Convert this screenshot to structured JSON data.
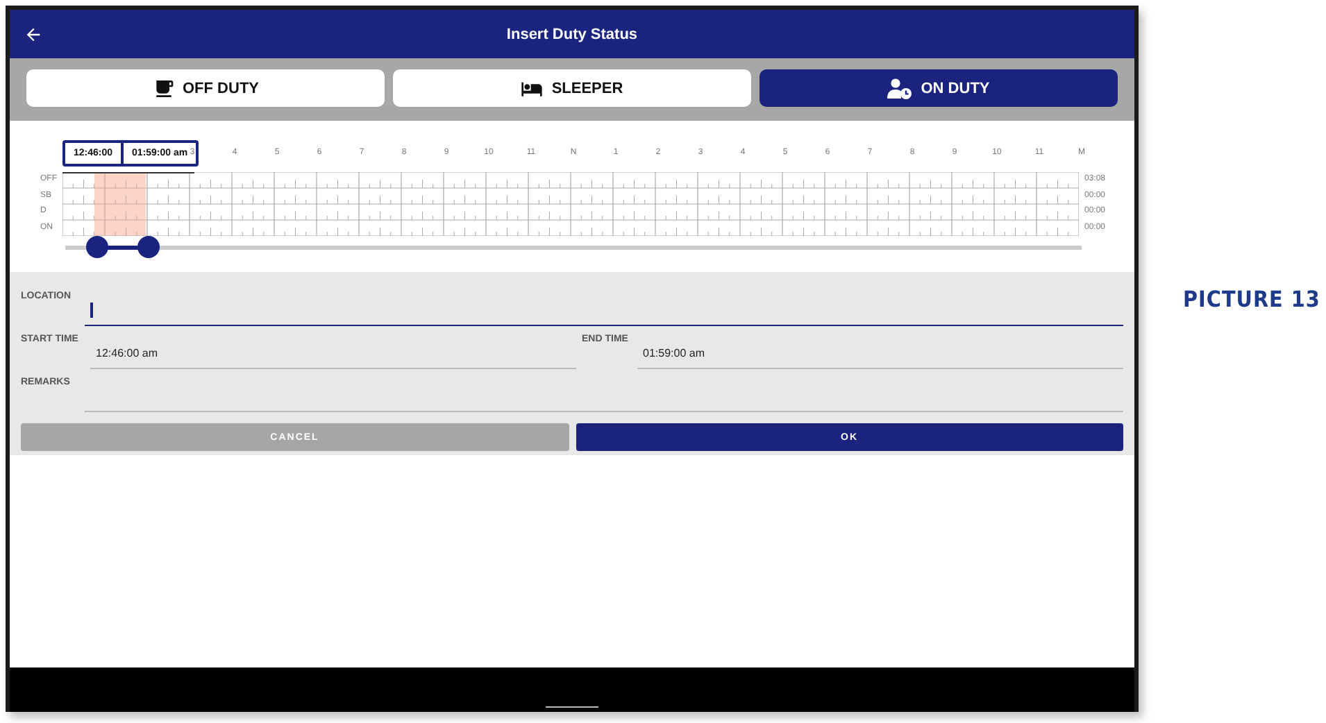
{
  "header": {
    "title": "Insert Duty Status"
  },
  "status_tabs": [
    {
      "label": "OFF DUTY",
      "kind": "off",
      "selected": false
    },
    {
      "label": "SLEEPER",
      "kind": "sleeper",
      "selected": false
    },
    {
      "label": "ON DUTY",
      "kind": "on",
      "selected": true
    }
  ],
  "log_chart": {
    "start_time": "12:46:00",
    "end_time": "01:59:00 am",
    "hour_labels": [
      "3",
      "4",
      "5",
      "6",
      "7",
      "8",
      "9",
      "10",
      "11",
      "N",
      "1",
      "2",
      "3",
      "4",
      "5",
      "6",
      "7",
      "8",
      "9",
      "10",
      "11",
      "M"
    ],
    "rows": [
      {
        "label": "OFF",
        "total": "03:08"
      },
      {
        "label": "SB",
        "total": "00:00"
      },
      {
        "label": "D",
        "total": "00:00"
      },
      {
        "label": "ON",
        "total": "00:00"
      }
    ],
    "thumbs": [
      {
        "level": 0.032
      },
      {
        "level": 0.082
      }
    ]
  },
  "form": {
    "location": {
      "label": "LOCATION",
      "focused": true
    },
    "start_time": {
      "label": "START TIME",
      "value": "12:46:00 am"
    },
    "end_time": {
      "label": "END TIME",
      "value": "01:59:00 am"
    },
    "remarks": {
      "label": "REMARKS"
    }
  },
  "buttons": [
    {
      "label": "CANCEL",
      "kind": "cancel"
    },
    {
      "label": "OK",
      "kind": "ok"
    }
  ],
  "caption": "PICTURE 13"
}
